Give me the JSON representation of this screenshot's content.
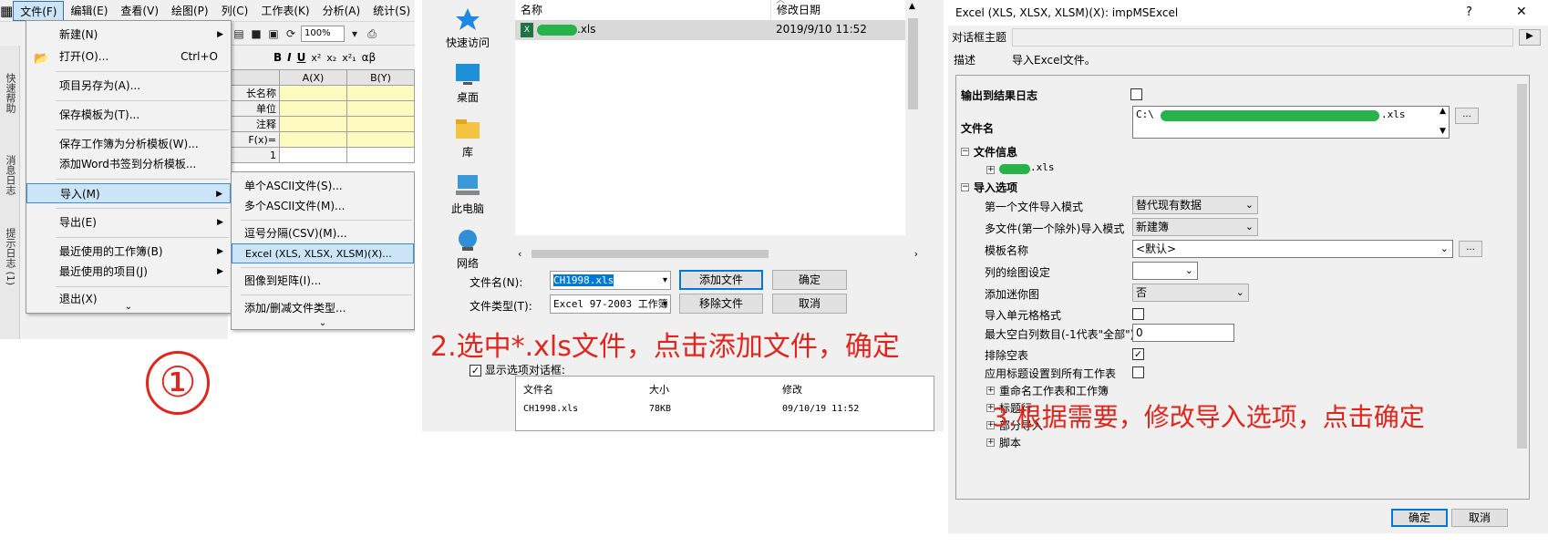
{
  "panel1": {
    "menubar": [
      "文件(F)",
      "编辑(E)",
      "查看(V)",
      "绘图(P)",
      "列(C)",
      "工作表(K)",
      "分析(A)",
      "统计(S)"
    ],
    "zoom": "100%",
    "toolbar_fmt": [
      "B",
      "I",
      "U",
      "x²",
      "x₂",
      "x²₁",
      "αβ"
    ],
    "columns": [
      "A(X)",
      "B(Y)"
    ],
    "row_headers": [
      "长名称",
      "单位",
      "注释",
      "F(x)=",
      "1"
    ],
    "side_labels": [
      "快速帮助",
      "消息日志",
      "提示日志 (1)"
    ],
    "file_menu": [
      {
        "label": "新建(N)",
        "arrow": true
      },
      {
        "label": "打开(O)...",
        "shortcut": "Ctrl+O"
      },
      {
        "label": "项目另存为(A)..."
      },
      {
        "label": "保存模板为(T)..."
      },
      {
        "label": "保存工作簿为分析模板(W)..."
      },
      {
        "label": "添加Word书签到分析模板..."
      },
      {
        "label": "导入(M)",
        "arrow": true
      },
      {
        "label": "导出(E)",
        "arrow": true
      },
      {
        "label": "最近使用的工作簿(B)",
        "arrow": true
      },
      {
        "label": "最近使用的项目(J)",
        "arrow": true
      },
      {
        "label": "退出(X)"
      }
    ],
    "import_menu": [
      "单个ASCII文件(S)...",
      "多个ASCII文件(M)...",
      "逗号分隔(CSV)(M)...",
      "Excel (XLS, XLSX, XLSM)(X)...",
      "图像到矩阵(I)...",
      "添加/删减文件类型..."
    ],
    "step_marker": "①"
  },
  "panel2": {
    "nav": [
      "快速访问",
      "桌面",
      "库",
      "此电脑",
      "网络"
    ],
    "col_name": "名称",
    "col_modified": "修改日期",
    "file_name_suffix": ".xls",
    "file_date": "2019/9/10 11:52",
    "filename_label": "文件名(N):",
    "filename_value": "CH1998.xls",
    "filetype_label": "文件类型(T):",
    "filetype_value": "Excel 97-2003 工作簿",
    "add_file_btn": "添加文件",
    "remove_file_btn": "移除文件",
    "ok_btn": "确定",
    "cancel_btn": "取消",
    "show_options": "显示选项对话框:",
    "table_headers": [
      "文件名",
      "大小",
      "修改"
    ],
    "table_row": [
      "CH1998.xls",
      "78KB",
      "09/10/19 11:52"
    ],
    "step2": "2.选中*.xls文件，点击添加文件，确定"
  },
  "panel3": {
    "title": "Excel (XLS, XLSX, XLSM)(X): impMSExcel",
    "help": "?",
    "close": "✕",
    "theme_label": "对话框主题",
    "desc_label": "描述",
    "desc_value": "导入Excel文件。",
    "output_log": "输出到结果日志",
    "filename_label": "文件名",
    "filename_prefix": "C:\\",
    "filename_suffix": ".xls",
    "file_info": "文件信息",
    "file_info_item_suffix": ".xls",
    "import_options": "导入选项",
    "first_mode_label": "第一个文件导入模式",
    "first_mode_value": "替代现有数据",
    "multi_mode_label": "多文件(第一个除外)导入模式",
    "multi_mode_value": "新建簿",
    "template_label": "模板名称",
    "template_value": "<默认>",
    "col_plot_label": "列的绘图设定",
    "col_plot_value": "",
    "sparkline_label": "添加迷你图",
    "sparkline_value": "否",
    "cell_format_label": "导入单元格格式",
    "max_blank_label": "最大空白列数目(-1代表\"全部\")",
    "max_blank_value": "0",
    "exclude_empty_label": "排除空表",
    "apply_header_label": "应用标题设置到所有工作表",
    "rename": "重命名工作表和工作簿",
    "header_rows": "标题行",
    "partial_import": "部分导入",
    "script": "脚本",
    "ok": "确定",
    "cancel": "取消",
    "step3": "3.根据需要，修改导入选项，点击确定"
  },
  "colors": {
    "step_red": "#e0261c",
    "highlight": "#cce4f7",
    "cell_yellow": "#fffbc0",
    "redact_green": "#27b34a"
  }
}
